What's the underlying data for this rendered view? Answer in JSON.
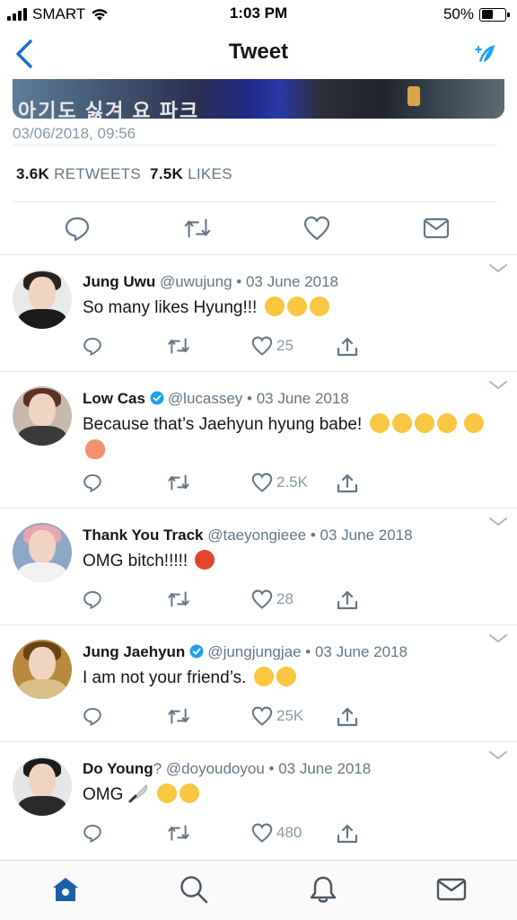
{
  "status_bar": {
    "carrier": "SMART",
    "time": "1:03 PM",
    "battery_percent": "50%",
    "battery_level": 0.5
  },
  "nav": {
    "title": "Tweet"
  },
  "media": {
    "overlay_text": "아기도 싫겨 요 파크"
  },
  "tweet": {
    "timestamp": "03/06/2018, 09:56",
    "retweets_count": "3.6K",
    "retweets_label": "RETWEETS",
    "likes_count": "7.5K",
    "likes_label": "LIKES"
  },
  "replies": [
    {
      "name": "Jung Uwu",
      "handle": "@uwujung",
      "date": "• 03 June 2018",
      "text": "So many likes Hyung!!!",
      "likes": "25",
      "verified": false
    },
    {
      "name": "Low Cas",
      "handle": "@lucassey",
      "date": "• 03 June 2018",
      "text": "Because that’s Jaehyun hyung babe!",
      "likes": "2.5K",
      "verified": true
    },
    {
      "name": "Thank You Track",
      "handle": "@taeyongieee",
      "date": "• 03 June 2018",
      "text": "OMG bitch!!!!!",
      "likes": "28",
      "verified": false
    },
    {
      "name": "Jung Jaehyun",
      "handle": "@jungjungjae",
      "date": "• 03 June 2018",
      "text": "I am not your friend’s.",
      "likes": "25K",
      "verified": true
    },
    {
      "name": "Do Young",
      "name_suffix": "?",
      "handle": "@doyoudoyou",
      "date": "• 03 June 2018",
      "text": "OMG",
      "likes": "480",
      "verified": false
    }
  ],
  "colors": {
    "accent": "#1da1f2",
    "nav_blue": "#1c5fa8",
    "muted": "#8899a6",
    "tabbar_active": "#1c5fa8"
  }
}
